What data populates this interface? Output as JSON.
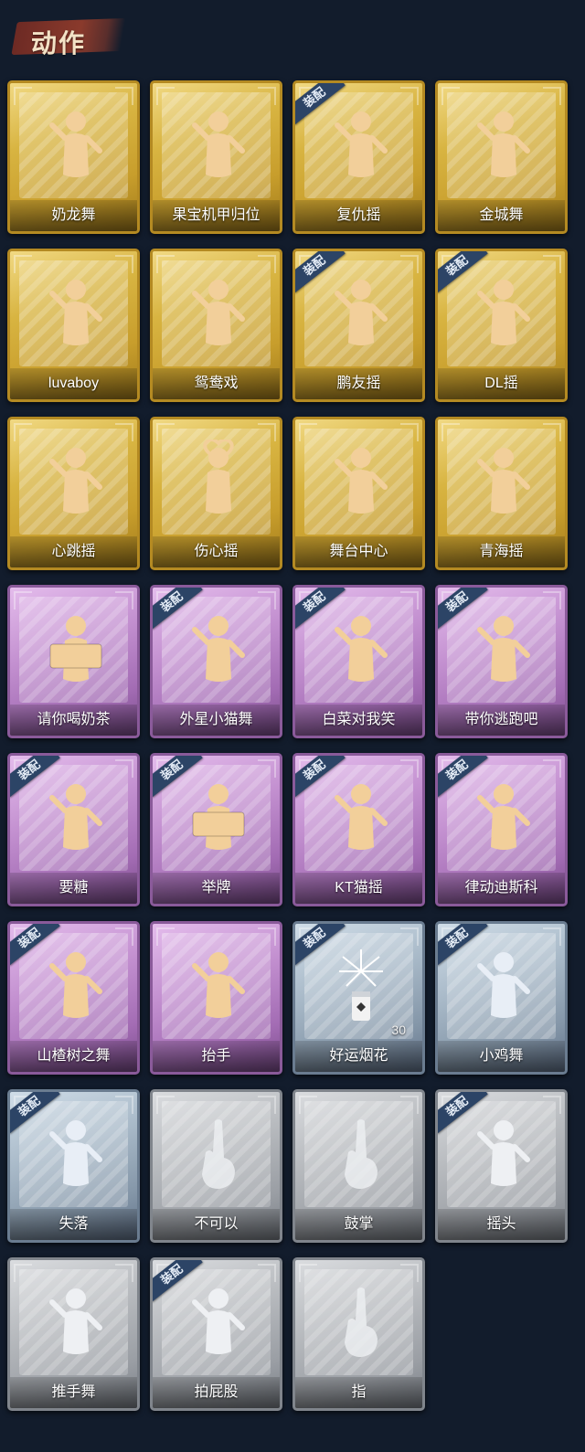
{
  "header": {
    "title": "动作"
  },
  "actions": [
    {
      "label": "奶龙舞",
      "tier": "gold",
      "equipped": false,
      "icon": "dancing-figure-icon"
    },
    {
      "label": "果宝机甲归位",
      "tier": "gold",
      "equipped": false,
      "icon": "dancing-figure-icon"
    },
    {
      "label": "复仇摇",
      "tier": "gold",
      "equipped": true,
      "icon": "dancing-figure-icon"
    },
    {
      "label": "金城舞",
      "tier": "gold",
      "equipped": false,
      "icon": "dancing-figure-icon"
    },
    {
      "label": "luvaboy",
      "tier": "gold",
      "equipped": false,
      "icon": "dancing-figure-icon"
    },
    {
      "label": "鸳鸯戏",
      "tier": "gold",
      "equipped": false,
      "icon": "dancing-figure-icon"
    },
    {
      "label": "鹏友摇",
      "tier": "gold",
      "equipped": true,
      "icon": "dancing-figure-icon"
    },
    {
      "label": "DL摇",
      "tier": "gold",
      "equipped": true,
      "icon": "dancing-figure-icon"
    },
    {
      "label": "心跳摇",
      "tier": "gold",
      "equipped": false,
      "icon": "dancing-figure-icon"
    },
    {
      "label": "伤心摇",
      "tier": "gold",
      "equipped": false,
      "icon": "heart-hands-figure-icon"
    },
    {
      "label": "舞台中心",
      "tier": "gold",
      "equipped": false,
      "icon": "dancing-figure-icon"
    },
    {
      "label": "青海摇",
      "tier": "gold",
      "equipped": false,
      "icon": "dancing-figure-icon"
    },
    {
      "label": "请你喝奶茶",
      "tier": "purple",
      "equipped": false,
      "icon": "sign-holding-figure-icon"
    },
    {
      "label": "外星小猫舞",
      "tier": "purple",
      "equipped": true,
      "icon": "dancing-figure-icon"
    },
    {
      "label": "白菜对我笑",
      "tier": "purple",
      "equipped": true,
      "icon": "dancing-figure-icon"
    },
    {
      "label": "带你逃跑吧",
      "tier": "purple",
      "equipped": true,
      "icon": "dancing-figure-icon"
    },
    {
      "label": "要糖",
      "tier": "purple",
      "equipped": true,
      "icon": "begging-figure-icon"
    },
    {
      "label": "举牌",
      "tier": "purple",
      "equipped": true,
      "icon": "sign-holding-figure-icon"
    },
    {
      "label": "KT猫摇",
      "tier": "purple",
      "equipped": true,
      "icon": "dancing-figure-icon"
    },
    {
      "label": "律动迪斯科",
      "tier": "purple",
      "equipped": true,
      "icon": "dancing-figure-icon"
    },
    {
      "label": "山楂树之舞",
      "tier": "purple",
      "equipped": true,
      "icon": "dancing-figure-icon"
    },
    {
      "label": "抬手",
      "tier": "purple",
      "equipped": false,
      "icon": "raise-hand-figure-icon"
    },
    {
      "label": "好运烟花",
      "tier": "blue",
      "equipped": true,
      "icon": "firework-icon",
      "count": "30"
    },
    {
      "label": "小鸡舞",
      "tier": "blue",
      "equipped": true,
      "icon": "chicken-dance-figure-icon"
    },
    {
      "label": "失落",
      "tier": "blue",
      "equipped": true,
      "icon": "crawling-figure-icon"
    },
    {
      "label": "不可以",
      "tier": "grey",
      "equipped": false,
      "icon": "finger-wag-icon"
    },
    {
      "label": "鼓掌",
      "tier": "grey",
      "equipped": false,
      "icon": "clapping-hands-icon"
    },
    {
      "label": "摇头",
      "tier": "grey",
      "equipped": true,
      "icon": "head-shake-figure-icon"
    },
    {
      "label": "推手舞",
      "tier": "grey",
      "equipped": false,
      "icon": "push-dance-figure-icon"
    },
    {
      "label": "拍屁股",
      "tier": "grey",
      "equipped": true,
      "icon": "butt-slap-figure-icon"
    },
    {
      "label": "指",
      "tier": "grey",
      "equipped": false,
      "icon": "pointing-hand-icon"
    }
  ],
  "equipped_badge": "装配",
  "colors": {
    "background": "#121c2c",
    "gold": "#d8b441",
    "purple": "#c390d0",
    "blue": "#a8b9c8",
    "grey": "#b7babe",
    "badge": "#2c4466"
  }
}
